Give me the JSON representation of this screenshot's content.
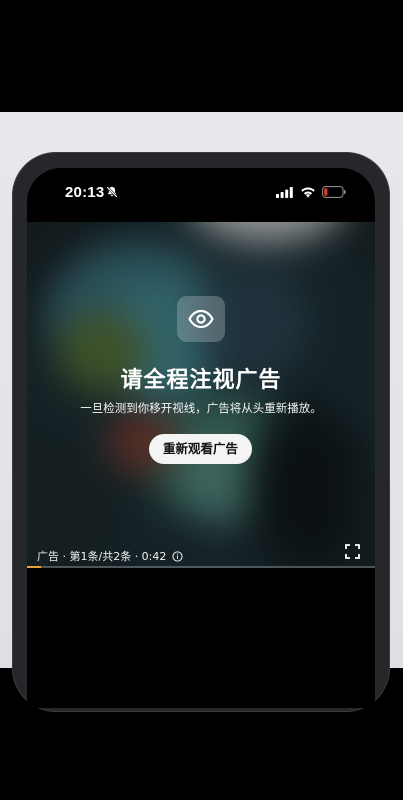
{
  "status_bar": {
    "time": "20:13",
    "silent_icon": "bell-slash-icon",
    "signal_icon": "cellular-signal-icon",
    "wifi_icon": "wifi-icon",
    "battery_icon": "battery-low-icon",
    "battery_color": "#e03b2f"
  },
  "ad_overlay": {
    "eye_icon": "eye-icon",
    "title": "请全程注视广告",
    "subtitle": "一旦检测到你移开视线，广告将从头重新播放。",
    "rewatch_button_label": "重新观看广告"
  },
  "ad_footer": {
    "info_text": "广告 · 第1条/共2条 · 0:42",
    "info_icon": "info-circle-icon",
    "fullscreen_icon": "fullscreen-icon",
    "progress": 0.04,
    "progress_color": "#e8a33a"
  }
}
